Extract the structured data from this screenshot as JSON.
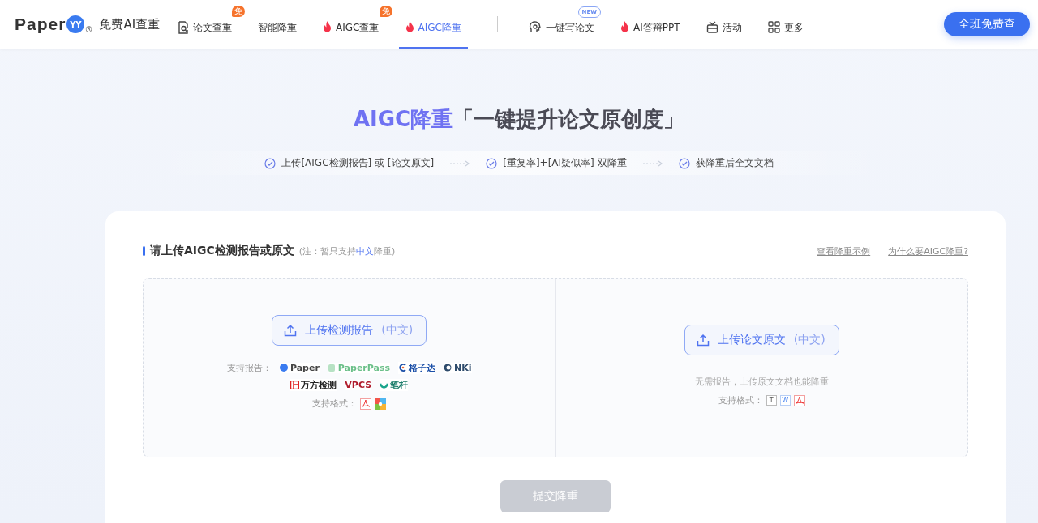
{
  "header": {
    "logo": {
      "word": "Paper",
      "mark": "YY",
      "registered": "®",
      "slogan": "免费AI查重"
    },
    "nav": [
      {
        "label": "论文查重",
        "kind": "document",
        "badge": "免",
        "selected": false
      },
      {
        "label": "智能降重",
        "kind": "plain",
        "selected": false
      },
      {
        "label": "AIGC查重",
        "kind": "hot",
        "badge": "免",
        "selected": false
      },
      {
        "label": "AIGC降重",
        "kind": "hot",
        "selected": true
      },
      {
        "kind": "divider"
      },
      {
        "label": "一键写论文",
        "kind": "writer",
        "badge": "NEW",
        "selected": false
      },
      {
        "label": "AI答辩PPT",
        "kind": "hot",
        "selected": false
      },
      {
        "label": "活动",
        "kind": "events",
        "selected": false
      },
      {
        "label": "更多",
        "kind": "more",
        "selected": false
      }
    ],
    "cta": "全班免费查"
  },
  "hero": {
    "title_accent": "AIGC降重",
    "title_rest": "「一键提升论文原创度」",
    "steps": [
      "上传[AIGC检测报告] 或 [论文原文]",
      "[重复率]+[AI疑似率] 双降重",
      "获降重后全文文档"
    ]
  },
  "card": {
    "heading": "请上传AIGC检测报告或原文",
    "note": "(注：暂只支持**中文**降重)",
    "links": [
      "查看降重示例",
      "为什么要AIGC降重?"
    ],
    "left": {
      "button": "上传检测报告",
      "button_hint": "(中文)",
      "reports_label": "支持报告：",
      "reports": [
        {
          "name": "Paper",
          "kind": "paperyy"
        },
        {
          "name": "PaperPass",
          "kind": "paperpass"
        },
        {
          "name": "格子达",
          "kind": "gezida"
        },
        {
          "name": "NKi",
          "kind": "cnki"
        },
        {
          "name": "万方检测",
          "kind": "wanfang"
        },
        {
          "name": "VPCS",
          "kind": "vpcs"
        },
        {
          "name": "笔杆",
          "kind": "bigan"
        }
      ],
      "formats_label": "支持格式：",
      "formats": [
        {
          "kind": "pdf"
        },
        {
          "kind": "image"
        }
      ]
    },
    "right": {
      "button": "上传论文原文",
      "button_hint": "(中文)",
      "hint": "无需报告，上传原文文档也能降重",
      "formats_label": "支持格式：",
      "formats": [
        {
          "kind": "txt",
          "letter": "T"
        },
        {
          "kind": "word",
          "letter": "W"
        },
        {
          "kind": "pdf"
        }
      ]
    },
    "submit": {
      "label": "提交降重",
      "disabled": true
    }
  }
}
